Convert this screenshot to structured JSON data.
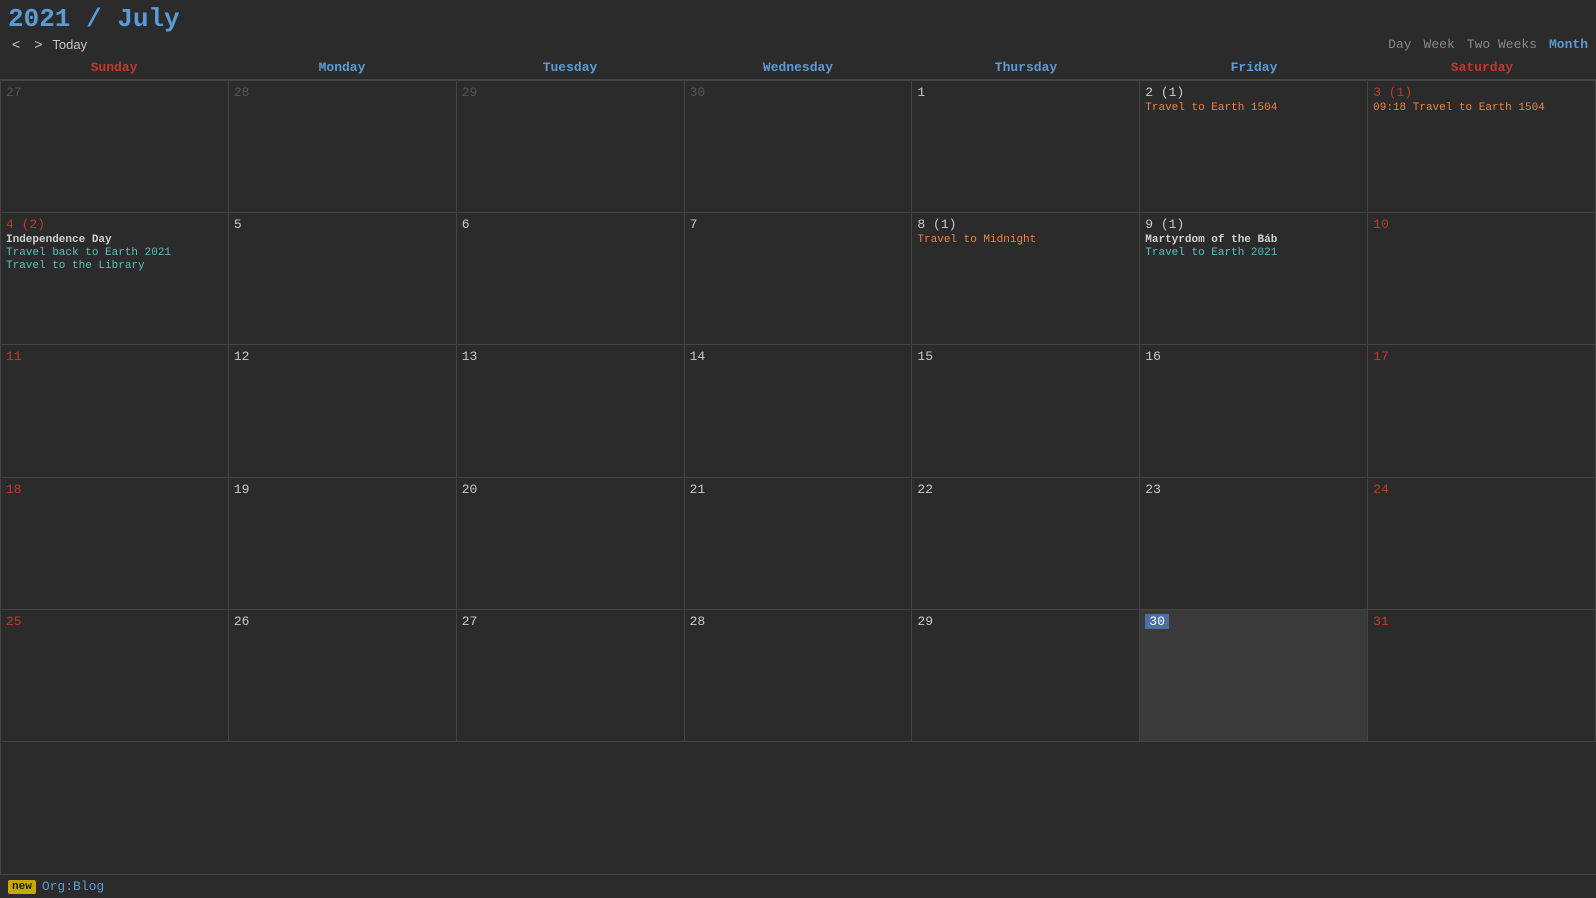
{
  "header": {
    "title_year": "2021",
    "title_slash": " / ",
    "title_month": "July",
    "nav_prev": "<",
    "nav_next": ">",
    "nav_today": "Today"
  },
  "views": {
    "day": "Day",
    "week": "Week",
    "two_weeks": "Two Weeks",
    "month": "Month",
    "active": "Month"
  },
  "day_headers": [
    {
      "label": "Sunday",
      "type": "weekend"
    },
    {
      "label": "Monday",
      "type": "weekday"
    },
    {
      "label": "Tuesday",
      "type": "weekday"
    },
    {
      "label": "Wednesday",
      "type": "weekday"
    },
    {
      "label": "Thursday",
      "type": "weekday"
    },
    {
      "label": "Friday",
      "type": "weekday"
    },
    {
      "label": "Saturday",
      "type": "weekend"
    }
  ],
  "weeks": [
    {
      "days": [
        {
          "num": "27",
          "type": "sunday",
          "other": true,
          "events": []
        },
        {
          "num": "28",
          "type": "weekday",
          "other": true,
          "events": []
        },
        {
          "num": "29",
          "type": "weekday",
          "other": true,
          "events": []
        },
        {
          "num": "30",
          "type": "weekday",
          "other": true,
          "events": []
        },
        {
          "num": "1",
          "type": "weekday",
          "other": false,
          "events": []
        },
        {
          "num": "2 (1)",
          "type": "weekday",
          "other": false,
          "events": [
            {
              "text": "Travel to Earth 1504",
              "color": "orange"
            }
          ]
        },
        {
          "num": "3 (1)",
          "type": "saturday",
          "other": false,
          "events": [
            {
              "text": "09:18 Travel to Earth 1504",
              "color": "orange"
            }
          ]
        }
      ]
    },
    {
      "days": [
        {
          "num": "4 (2)",
          "type": "sunday",
          "other": false,
          "events": [
            {
              "text": "Independence Day",
              "color": "white",
              "bold": true
            },
            {
              "text": "Travel back to Earth 2021",
              "color": "teal"
            },
            {
              "text": "Travel to the Library",
              "color": "teal"
            }
          ]
        },
        {
          "num": "5",
          "type": "weekday",
          "other": false,
          "events": []
        },
        {
          "num": "6",
          "type": "weekday",
          "other": false,
          "events": []
        },
        {
          "num": "7",
          "type": "weekday",
          "other": false,
          "events": []
        },
        {
          "num": "8 (1)",
          "type": "weekday",
          "other": false,
          "events": [
            {
              "text": "Travel to Midnight",
              "color": "orange"
            }
          ]
        },
        {
          "num": "9 (1)",
          "type": "weekday",
          "other": false,
          "events": [
            {
              "text": "Martyrdom of the Báb",
              "color": "white",
              "bold": true
            },
            {
              "text": "Travel to Earth 2021",
              "color": "teal"
            }
          ]
        },
        {
          "num": "10",
          "type": "saturday",
          "other": false,
          "events": []
        }
      ]
    },
    {
      "days": [
        {
          "num": "11",
          "type": "sunday",
          "other": false,
          "events": []
        },
        {
          "num": "12",
          "type": "weekday",
          "other": false,
          "events": []
        },
        {
          "num": "13",
          "type": "weekday",
          "other": false,
          "events": []
        },
        {
          "num": "14",
          "type": "weekday",
          "other": false,
          "events": []
        },
        {
          "num": "15",
          "type": "weekday",
          "other": false,
          "events": []
        },
        {
          "num": "16",
          "type": "weekday",
          "other": false,
          "events": []
        },
        {
          "num": "17",
          "type": "saturday",
          "other": false,
          "events": []
        }
      ]
    },
    {
      "days": [
        {
          "num": "18",
          "type": "sunday",
          "other": false,
          "events": []
        },
        {
          "num": "19",
          "type": "weekday",
          "other": false,
          "events": []
        },
        {
          "num": "20",
          "type": "weekday",
          "other": false,
          "events": []
        },
        {
          "num": "21",
          "type": "weekday",
          "other": false,
          "events": []
        },
        {
          "num": "22",
          "type": "weekday",
          "other": false,
          "events": []
        },
        {
          "num": "23",
          "type": "weekday",
          "other": false,
          "events": []
        },
        {
          "num": "24",
          "type": "saturday",
          "other": false,
          "events": []
        }
      ]
    },
    {
      "days": [
        {
          "num": "25",
          "type": "sunday",
          "other": false,
          "events": []
        },
        {
          "num": "26",
          "type": "weekday",
          "other": false,
          "events": []
        },
        {
          "num": "27",
          "type": "weekday",
          "other": false,
          "events": []
        },
        {
          "num": "28",
          "type": "weekday",
          "other": false,
          "events": []
        },
        {
          "num": "29",
          "type": "weekday",
          "other": false,
          "events": []
        },
        {
          "num": "30",
          "type": "weekday",
          "other": false,
          "today": true,
          "events": []
        },
        {
          "num": "31",
          "type": "saturday",
          "other": false,
          "events": []
        }
      ]
    }
  ],
  "footer": {
    "tag": "new",
    "label": "Org:Blog"
  }
}
